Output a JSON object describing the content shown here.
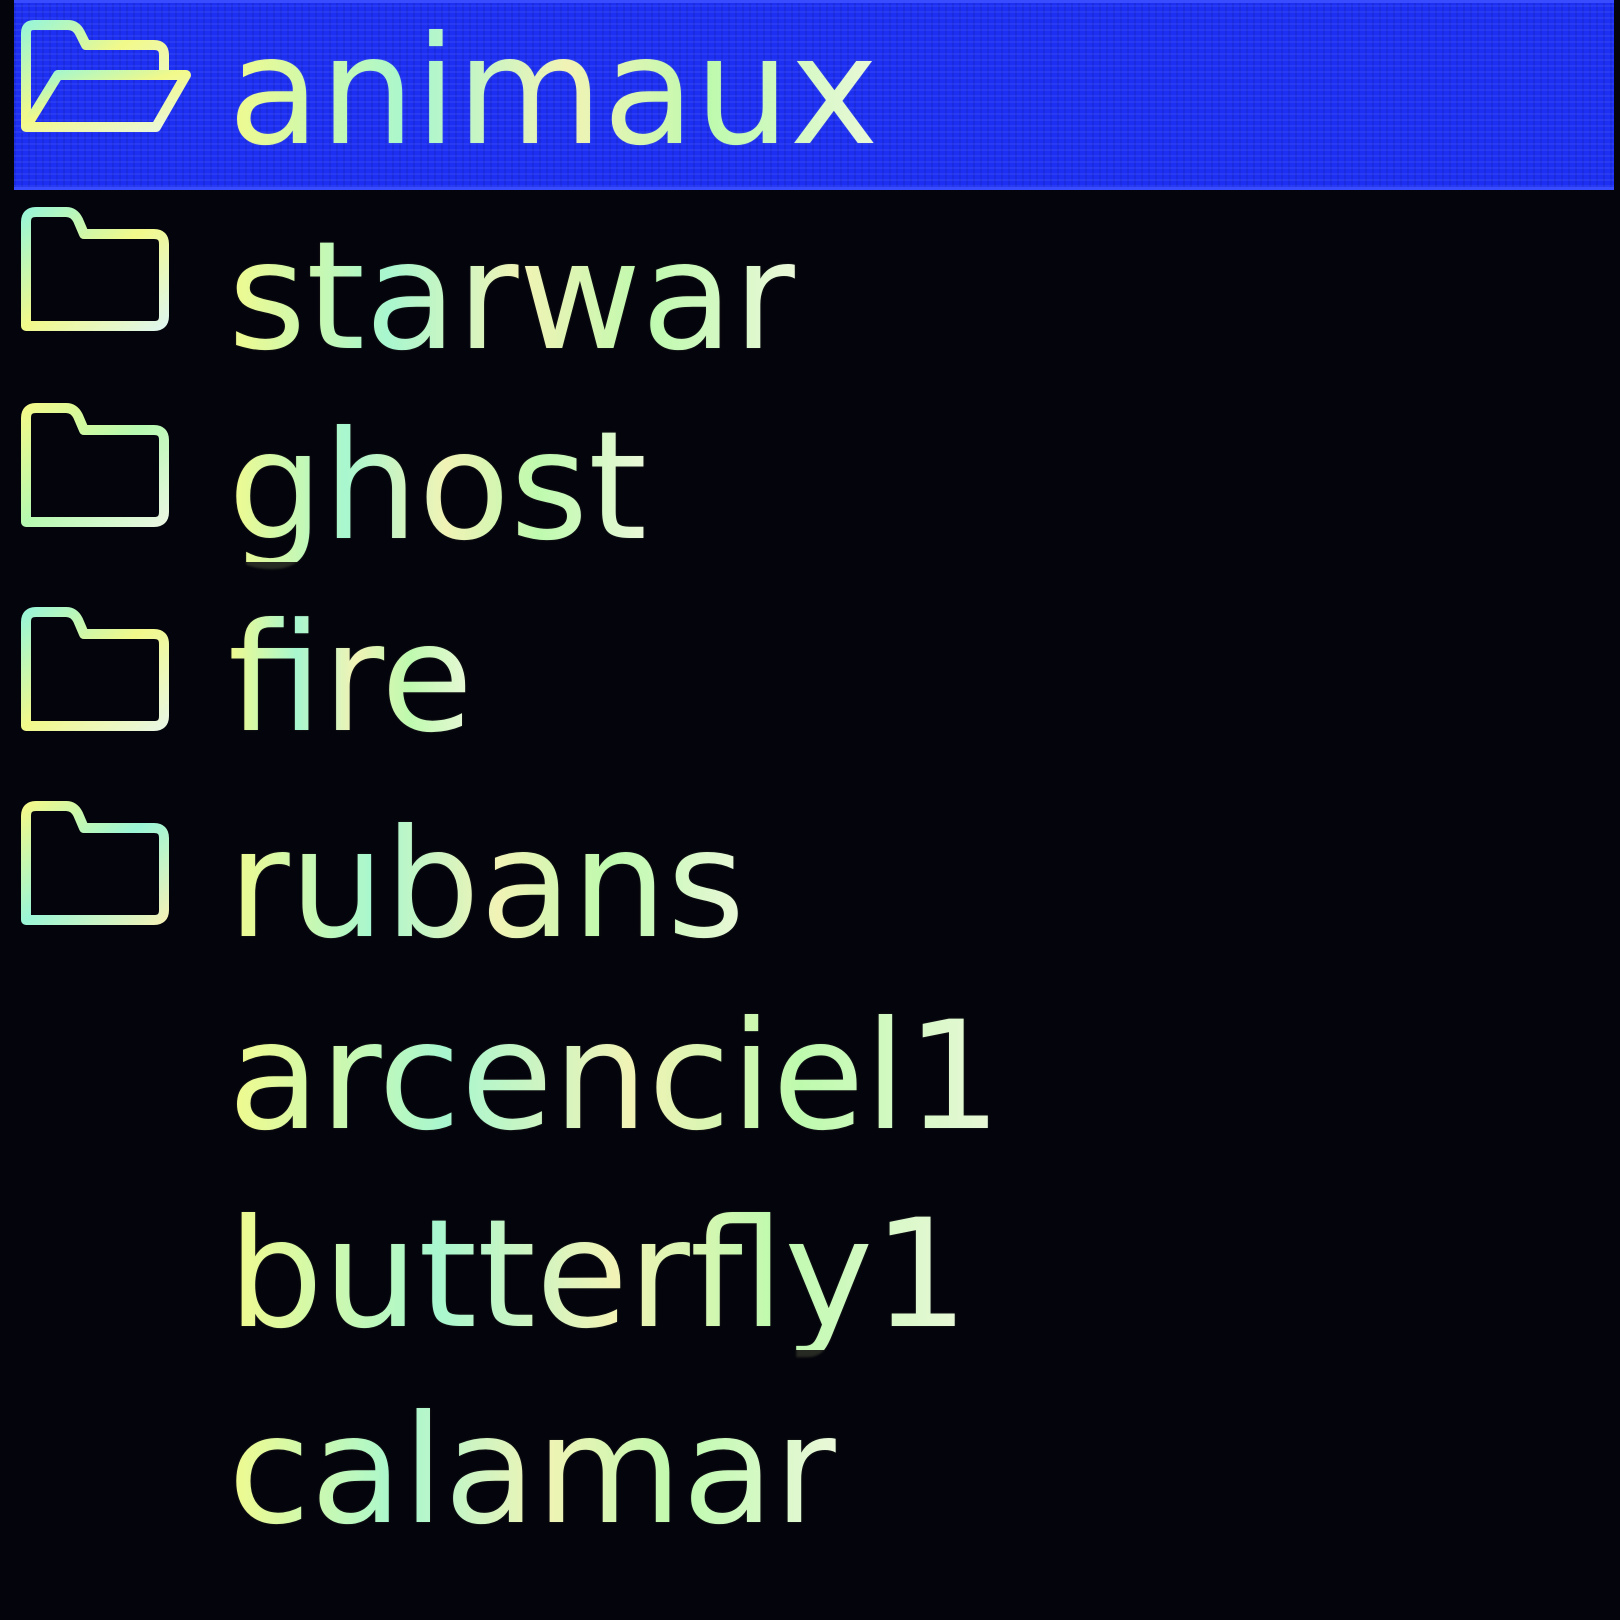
{
  "file_browser": {
    "items": [
      {
        "label": "animaux",
        "type": "folder",
        "icon": "folder-open-icon",
        "selected": true
      },
      {
        "label": "starwar",
        "type": "folder",
        "icon": "folder-icon",
        "selected": false
      },
      {
        "label": "ghost",
        "type": "folder",
        "icon": "folder-icon",
        "selected": false
      },
      {
        "label": "fire",
        "type": "folder",
        "icon": "folder-icon",
        "selected": false
      },
      {
        "label": "rubans",
        "type": "folder",
        "icon": "folder-icon",
        "selected": false
      },
      {
        "label": "arcenciel1",
        "type": "file",
        "selected": false
      },
      {
        "label": "butterfly1",
        "type": "file",
        "selected": false
      },
      {
        "label": "calamar",
        "type": "file",
        "selected": false
      }
    ]
  },
  "colors": {
    "background": "#04040c",
    "selection": "#1c2ff2",
    "text": "#e8f4c8",
    "icon_outline": "#e8ec8c"
  }
}
